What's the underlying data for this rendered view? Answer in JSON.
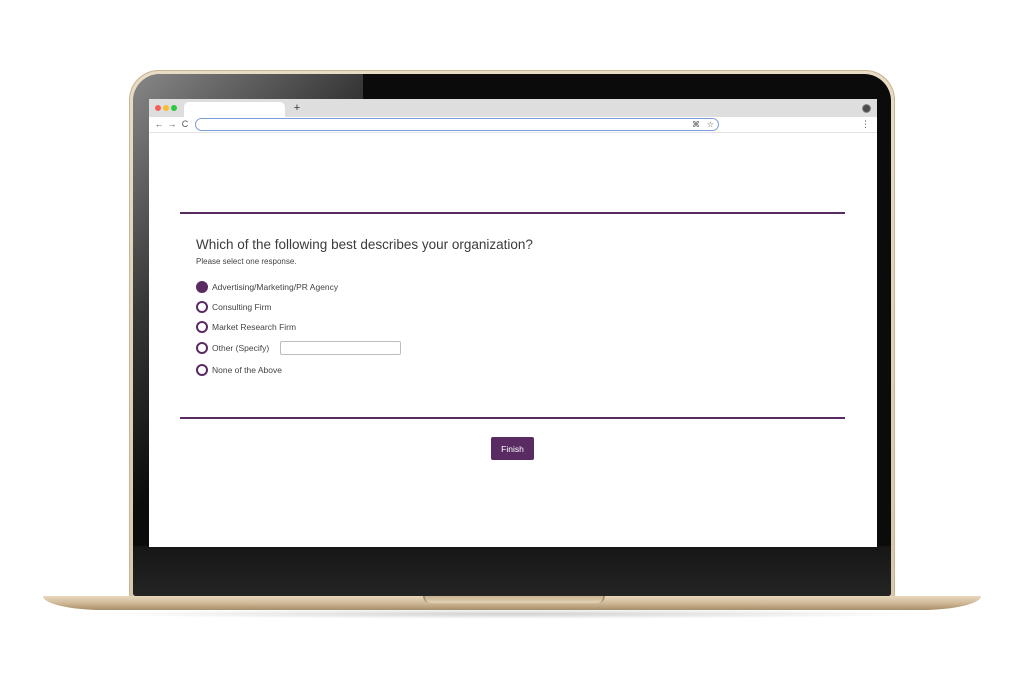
{
  "browser": {
    "new_tab_label": "+",
    "icons": {
      "back": "arrow-left-icon",
      "forward": "arrow-right-icon",
      "reload": "reload-icon",
      "command": "command-icon",
      "bookmark": "star-icon",
      "menu": "vertical-dots-icon"
    },
    "glyphs": {
      "back": "←",
      "forward": "→",
      "reload": "C",
      "command": "⌘",
      "bookmark": "☆",
      "menu": "⋮"
    }
  },
  "survey": {
    "question": "Which of the following best describes your organization?",
    "instruction": "Please select one response.",
    "options": [
      {
        "label": "Advertising/Marketing/PR Agency",
        "selected": true
      },
      {
        "label": "Consulting Firm",
        "selected": false
      },
      {
        "label": "Market Research Firm",
        "selected": false
      },
      {
        "label": "Other (Specify)",
        "selected": false
      },
      {
        "label": "None of the Above",
        "selected": false
      }
    ],
    "other_specify_value": "",
    "finish_label": "Finish"
  },
  "colors": {
    "accent": "#5a2a63",
    "text": "#3b3b3b"
  }
}
